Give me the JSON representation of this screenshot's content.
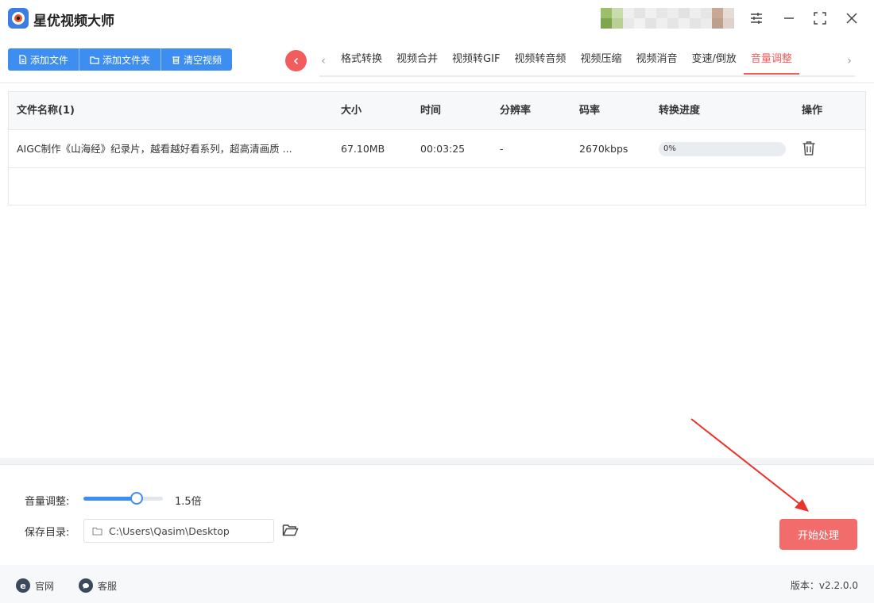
{
  "app": {
    "title": "星优视频大师"
  },
  "toolbar": {
    "add_file": "添加文件",
    "add_folder": "添加文件夹",
    "clear_videos": "清空视频"
  },
  "tabs": [
    {
      "label": "格式转换"
    },
    {
      "label": "视频合并"
    },
    {
      "label": "视频转GIF"
    },
    {
      "label": "视频转音频"
    },
    {
      "label": "视频压缩"
    },
    {
      "label": "视频消音"
    },
    {
      "label": "变速/倒放"
    },
    {
      "label": "音量调整",
      "active": true
    }
  ],
  "table": {
    "headers": {
      "name": "文件名称(1)",
      "size": "大小",
      "time": "时间",
      "resolution": "分辨率",
      "bitrate": "码率",
      "progress": "转换进度",
      "action": "操作"
    },
    "rows": [
      {
        "name": "AIGC制作《山海经》纪录片，越看越好看系列，超高清画质 ...",
        "size": "67.10MB",
        "time": "00:03:25",
        "resolution": "-",
        "bitrate": "2670kbps",
        "progress_text": "0%",
        "progress": 0
      }
    ]
  },
  "settings": {
    "volume_label": "音量调整:",
    "volume_value_text": "1.5倍",
    "volume_fraction": 0.67,
    "save_dir_label": "保存目录:",
    "save_dir_value": "C:\\Users\\Qasim\\Desktop",
    "start_label": "开始处理"
  },
  "footer": {
    "website": "官网",
    "support": "客服",
    "version": "版本：v2.2.0.0"
  },
  "colors": {
    "accent": "#3d8ef0",
    "active_tab": "#f25c5c",
    "start_button": "#f36c6c"
  }
}
